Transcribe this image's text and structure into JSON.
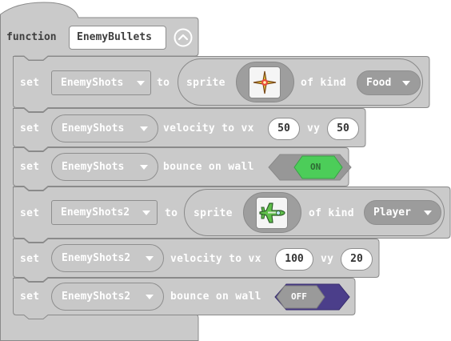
{
  "function": {
    "keyword": "function",
    "name": "EnemyBullets",
    "collapse_icon": "chevron-up-circle-icon"
  },
  "blocks": [
    {
      "set": "set",
      "variable": "EnemyShots",
      "to": "to",
      "sprite": "sprite",
      "image": "yellow-sparkle-sprite",
      "of_kind": "of kind",
      "kind": "Food"
    },
    {
      "set": "set",
      "variable": "EnemyShots",
      "velocity": "velocity to vx",
      "vx": "50",
      "vy_label": "vy",
      "vy": "50"
    },
    {
      "set": "set",
      "variable": "EnemyShots",
      "bounce": "bounce on wall",
      "toggle": "ON",
      "toggle_color": "#4ccd59"
    },
    {
      "set": "set",
      "variable": "EnemyShots2",
      "to": "to",
      "sprite": "sprite",
      "image": "green-plane-sprite",
      "of_kind": "of kind",
      "kind": "Player"
    },
    {
      "set": "set",
      "variable": "EnemyShots2",
      "velocity": "velocity to vx",
      "vx": "100",
      "vy_label": "vy",
      "vy": "20"
    },
    {
      "set": "set",
      "variable": "EnemyShots2",
      "bounce": "bounce on wall",
      "toggle": "OFF",
      "toggle_color": "#4b3e8a"
    }
  ],
  "colors": {
    "block": "#cacaca",
    "outline": "#8a8a8a",
    "on": "#4ccd59",
    "off": "#4b3e8a"
  }
}
